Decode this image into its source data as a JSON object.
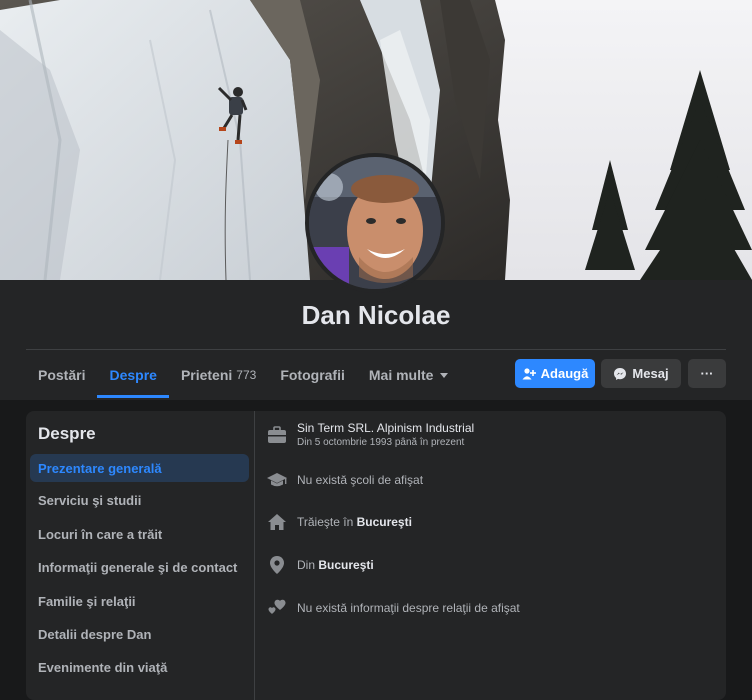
{
  "profile": {
    "name": "Dan Nicolae"
  },
  "tabs": [
    {
      "label": "Postări",
      "count": ""
    },
    {
      "label": "Despre",
      "count": ""
    },
    {
      "label": "Prieteni",
      "count": "773"
    },
    {
      "label": "Fotografii",
      "count": ""
    },
    {
      "label": "Mai multe",
      "count": ""
    }
  ],
  "actions": {
    "add_label": "Adaugă",
    "message_label": "Mesaj",
    "more_label": "···"
  },
  "about": {
    "title": "Despre",
    "menu": [
      "Prezentare generală",
      "Serviciu şi studii",
      "Locuri în care a trăit",
      "Informaţii generale şi de contact",
      "Familie şi relaţii",
      "Detalii despre Dan",
      "Evenimente din viaţă"
    ],
    "work": {
      "title": "Sin Term SRL. Alpinism Industrial",
      "subtitle": "Din 5 octombrie 1993 până în prezent"
    },
    "school": "Nu există şcoli de afişat",
    "lives_prefix": "Trăieşte în ",
    "lives_city": "Bucureşti",
    "from_prefix": "Din ",
    "from_city": "Bucureşti",
    "relationship": "Nu există informaţii despre relaţii de afişat"
  },
  "icons": {
    "work": "briefcase-icon",
    "school": "graduation-cap-icon",
    "home": "home-icon",
    "location": "map-pin-icon",
    "relationship": "hearts-icon"
  },
  "colors": {
    "accent": "#2d88ff",
    "background": "#18191a",
    "panel": "#242526"
  }
}
